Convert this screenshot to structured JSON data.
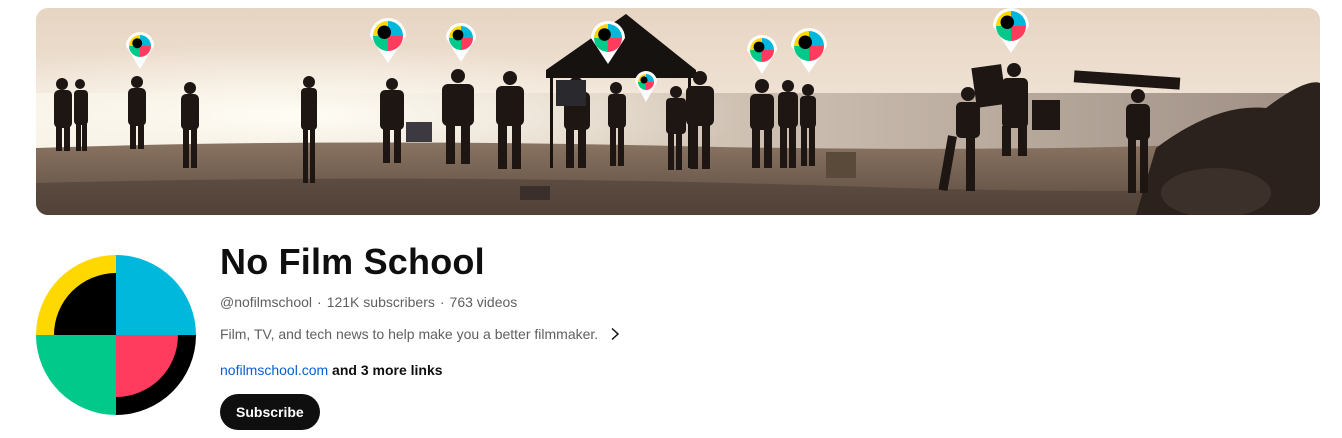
{
  "channel": {
    "name": "No Film School",
    "handle": "@nofilmschool",
    "separator": "·",
    "subscribers": "121K subscribers",
    "videos": "763 videos",
    "description": "Film, TV, and tech news to help make you a better filmmaker.",
    "link_primary": "nofilmschool.com",
    "link_more": "and 3 more links",
    "subscribe_label": "Subscribe"
  },
  "icons": {
    "description_expand": "chevron-right-icon",
    "banner_pins": "map-pin-logo-icon",
    "avatar": "no-film-school-logo"
  },
  "colors": {
    "logo_yellow": "#FFD800",
    "logo_cyan": "#00B8DB",
    "logo_green": "#00C98A",
    "logo_pink": "#FF3B5E",
    "logo_black": "#000000",
    "link_blue": "#065fd4",
    "subscribe_bg": "#0f0f0f",
    "subscribe_text": "#ffffff"
  }
}
